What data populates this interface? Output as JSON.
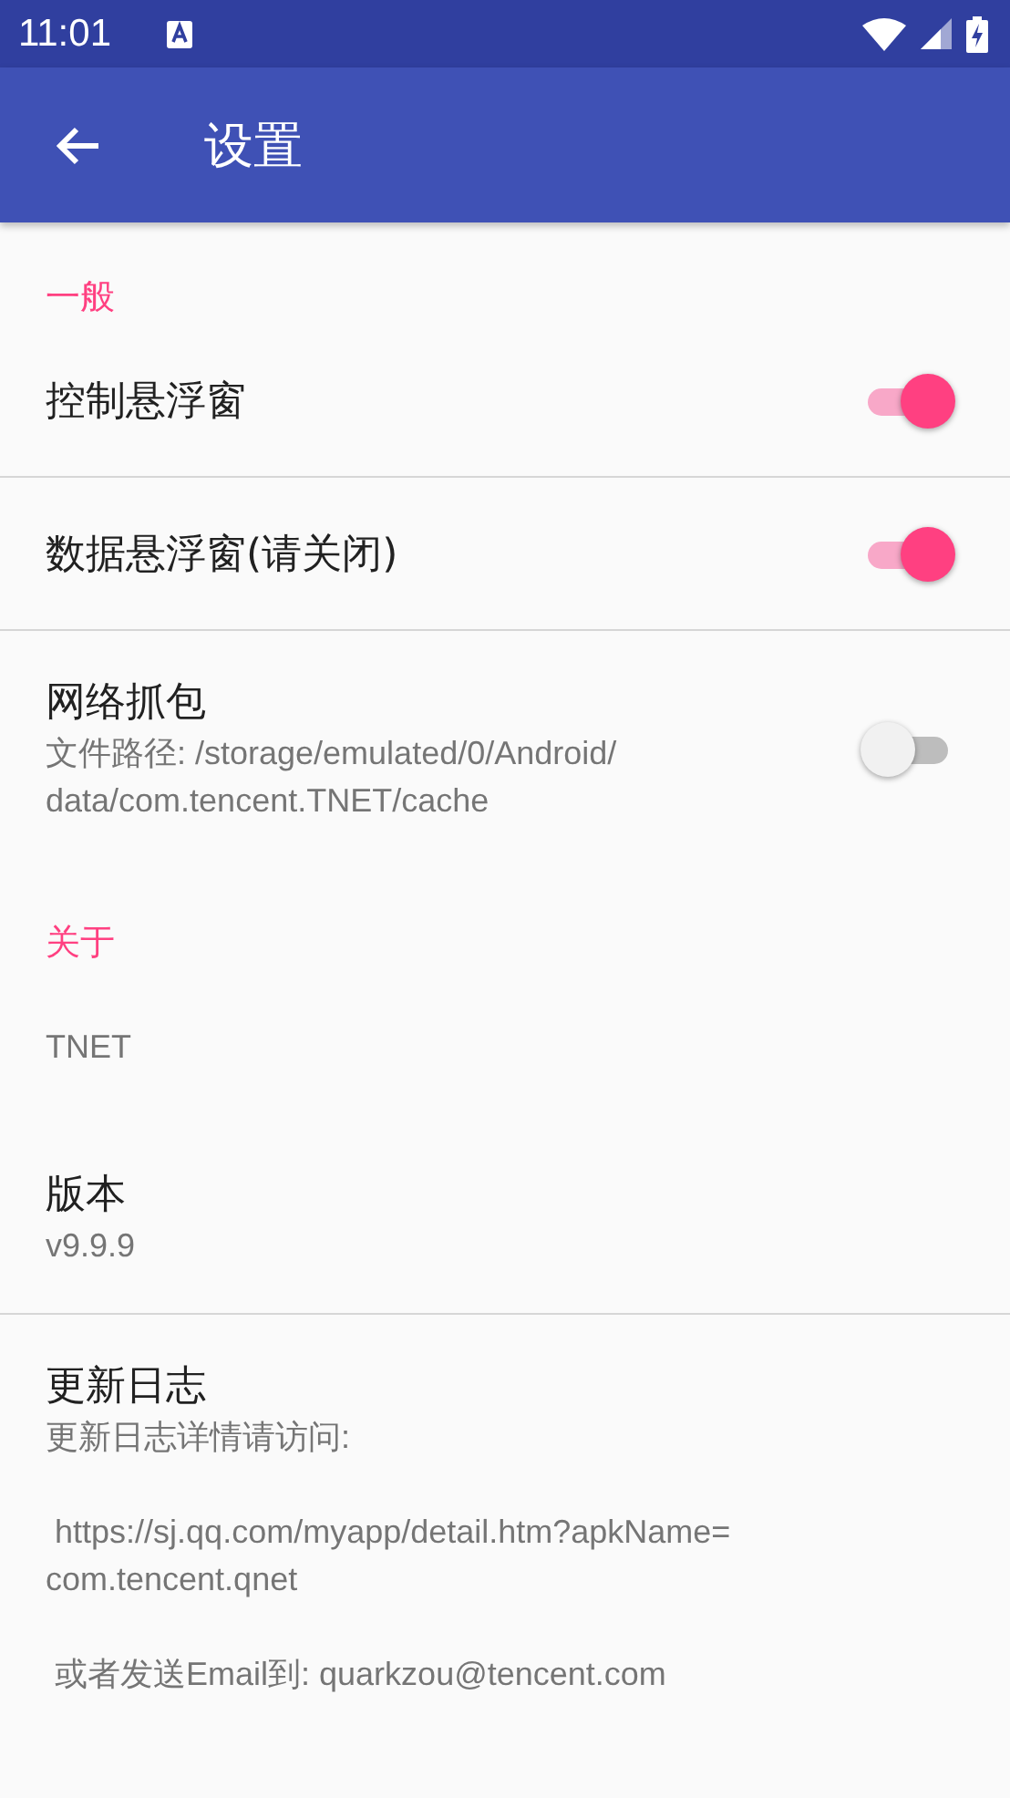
{
  "status_bar": {
    "time": "11:01"
  },
  "app_bar": {
    "title": "设置"
  },
  "items": [
    {
      "kind": "header",
      "title": "一般"
    },
    {
      "kind": "switch",
      "title": "控制悬浮窗",
      "on": true,
      "divider_below": true
    },
    {
      "kind": "switch",
      "title": "数据悬浮窗(请关闭)",
      "on": true,
      "divider_below": true
    },
    {
      "kind": "switch",
      "title": "网络抓包",
      "summary": "文件路径: /storage/emulated/0/Android/\ndata/com.tencent.TNET/cache",
      "on": false,
      "divider_below": false
    },
    {
      "kind": "header",
      "title": "关于"
    },
    {
      "kind": "plain",
      "summary": "TNET",
      "divider_below": false
    },
    {
      "kind": "plain",
      "title": "版本",
      "summary": "v9.9.9",
      "divider_below": true
    },
    {
      "kind": "plain",
      "title": "更新日志",
      "summary": "更新日志详情请访问:\n\n https://sj.qq.com/myapp/detail.htm?apkName=\ncom.tencent.qnet\n\n 或者发送Email到: quarkzou@tencent.com",
      "divider_below": false
    }
  ]
}
